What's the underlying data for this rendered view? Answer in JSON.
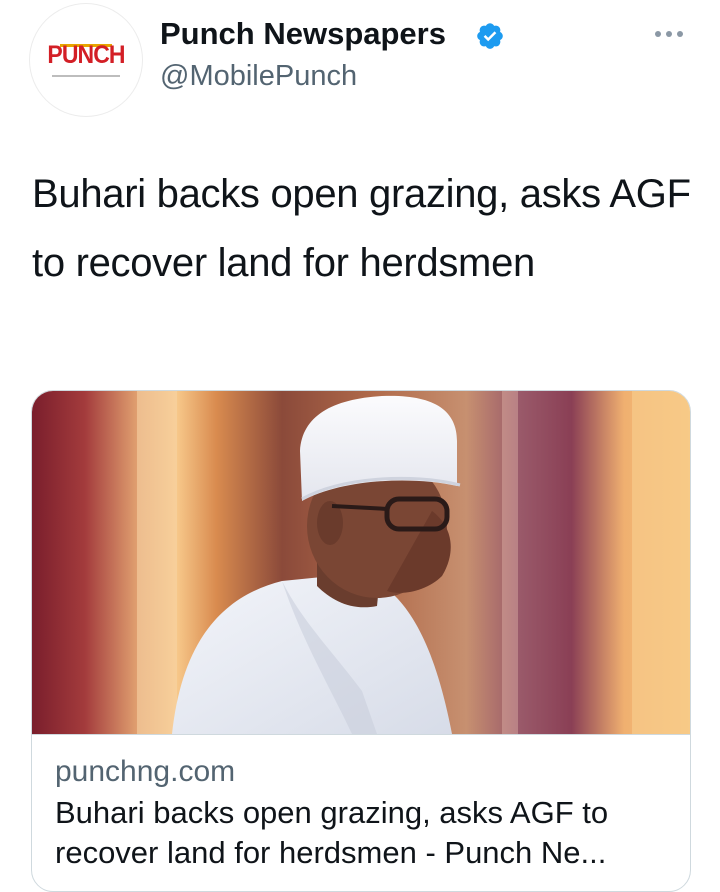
{
  "tweet": {
    "author": {
      "display_name": "Punch Newspapers",
      "handle": "@MobilePunch",
      "avatar_logo_text": "PUNCH",
      "verified": true
    },
    "more_icon": "more-horizontal-icon",
    "text": "Buhari backs open grazing, asks AGF to recover land for herdsmen",
    "card": {
      "domain": "punchng.com",
      "title": "Buhari backs open grazing, asks AGF to recover land for herdsmen - Punch Ne..."
    }
  },
  "colors": {
    "verified_badge": "#1d9bf0",
    "brand_red": "#d31f26",
    "secondary_text": "#536471",
    "border": "#cfd9de"
  }
}
